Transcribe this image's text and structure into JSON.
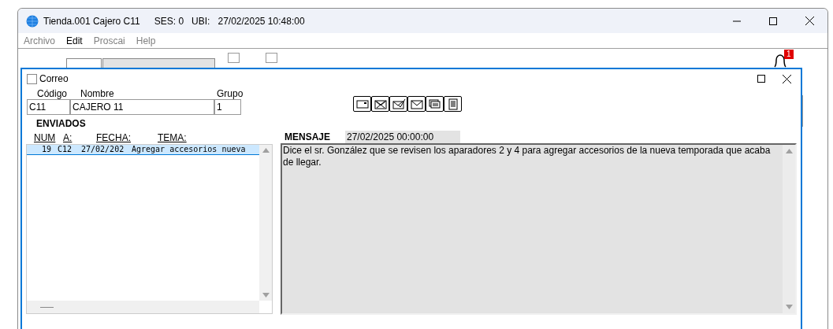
{
  "window": {
    "title_parts": [
      "Tienda.001  Cajero C11",
      "SES: 0",
      "UBI:",
      "27/02/2025 10:48:00"
    ]
  },
  "menu": [
    {
      "label": "Archivo",
      "disabled": true
    },
    {
      "label": "Edit",
      "disabled": false
    },
    {
      "label": "Proscai",
      "disabled": true
    },
    {
      "label": "Help",
      "disabled": true
    }
  ],
  "background": {
    "checkboxes": [
      {
        "checked": false
      },
      {
        "checked": false
      }
    ],
    "badge": "1"
  },
  "dialog": {
    "title": "Correo",
    "checked": false,
    "fields": [
      {
        "label": "Código",
        "value": "C11"
      },
      {
        "label": "Nombre",
        "value": "CAJERO 11"
      },
      {
        "label": "Grupo",
        "value": "1"
      }
    ],
    "sent": {
      "title": "ENVIADOS",
      "columns": [
        "NUM",
        "A:",
        "FECHA:",
        "TEMA:"
      ],
      "rows": [
        {
          "cells": [
            "19",
            "C12",
            "27/02/202",
            "Agregar accesorios nueva"
          ],
          "selected": true
        }
      ]
    },
    "message": {
      "label": "MENSAJE",
      "date": "27/02/2025 00:00:00",
      "text": "Dice el sr. González que se revisen los aparadores 2 y 4 para agregar accesorios de la nueva temporada que acaba de llegar."
    }
  }
}
